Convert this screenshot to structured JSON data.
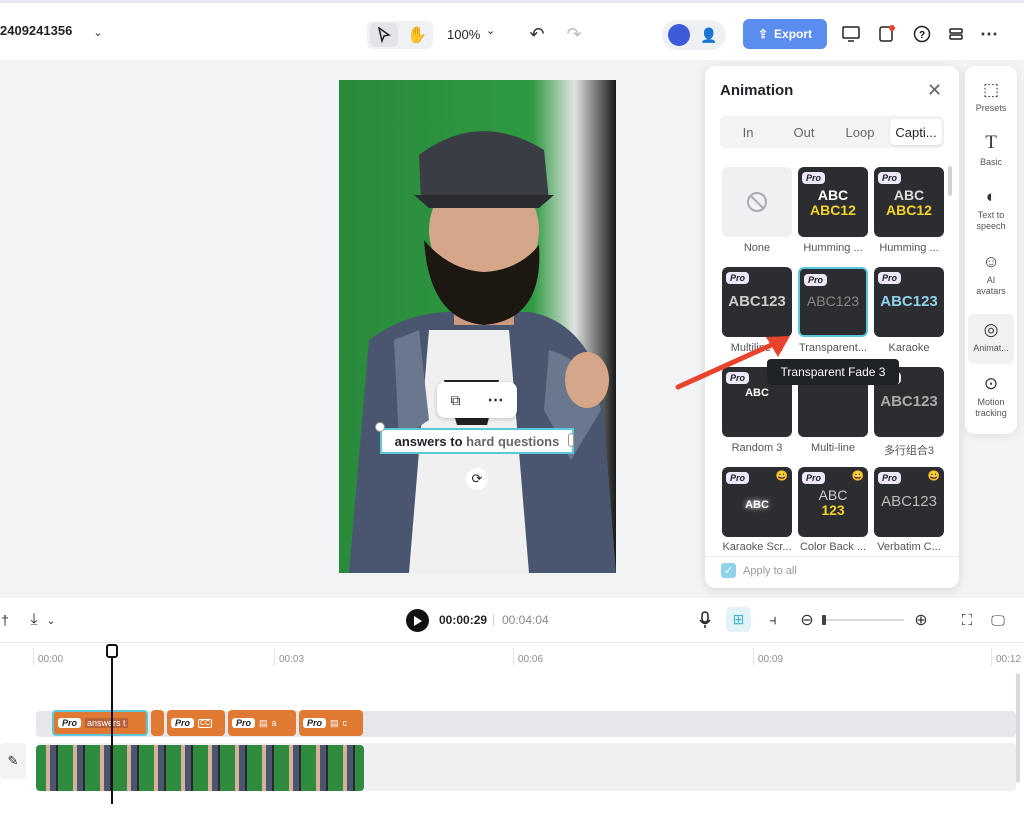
{
  "header": {
    "project_name": "2409241356",
    "zoom": "100%",
    "export_label": "Export"
  },
  "animation_panel": {
    "title": "Animation",
    "tabs": [
      {
        "label": "In",
        "active": false
      },
      {
        "label": "Out",
        "active": false
      },
      {
        "label": "Loop",
        "active": false
      },
      {
        "label": "Capti...",
        "active": true
      }
    ],
    "tiles": [
      {
        "label": "None",
        "pro": false,
        "preview": ""
      },
      {
        "label": "Humming ...",
        "pro": true,
        "preview": "ABC ABC12"
      },
      {
        "label": "Humming ...",
        "pro": true,
        "preview": "ABC ABC12"
      },
      {
        "label": "Multiline ...",
        "pro": true,
        "preview": "ABC123"
      },
      {
        "label": "Transparent...",
        "pro": true,
        "preview": "ABC123",
        "selected": true
      },
      {
        "label": "Karaoke",
        "pro": true,
        "preview": "ABC123"
      },
      {
        "label": "Random 3",
        "pro": true,
        "preview": "ABC"
      },
      {
        "label": "Multi-line",
        "pro": false,
        "preview": ""
      },
      {
        "label": "多行组合3",
        "pro": true,
        "preview": "ABC123"
      },
      {
        "label": "Karaoke Scr...",
        "pro": true,
        "preview": "ABC"
      },
      {
        "label": "Color Back ...",
        "pro": true,
        "preview": "ABC 123"
      },
      {
        "label": "Verbatim C...",
        "pro": true,
        "preview": "ABC123"
      }
    ],
    "pro_badge": "Pro",
    "apply_to_all": "Apply to all",
    "tooltip": "Transparent Fade 3"
  },
  "rail": [
    {
      "label": "Presets",
      "icon": "presets-icon"
    },
    {
      "label": "Basic",
      "icon": "text-icon"
    },
    {
      "label": "Text to speech",
      "icon": "speech-icon"
    },
    {
      "label": "AI avatars",
      "icon": "avatar-icon"
    },
    {
      "label": "Animat...",
      "icon": "animation-icon",
      "active": true
    },
    {
      "label": "Motion tracking",
      "icon": "motion-tracking-icon"
    }
  ],
  "caption": {
    "text_a": "answers to ",
    "text_b": "hard ",
    "text_c": "questions"
  },
  "playback": {
    "current_time": "00:00:29",
    "total_time": "00:04:04"
  },
  "timeline": {
    "ticks": [
      "00:00",
      "00:03",
      "00:06",
      "00:09",
      "00:12"
    ],
    "clips": [
      {
        "pro": "Pro",
        "text": "answers t"
      },
      {
        "pro": "",
        "text": ""
      },
      {
        "pro": "Pro",
        "text": "CC"
      },
      {
        "pro": "Pro",
        "text": "a"
      },
      {
        "pro": "Pro",
        "text": "c"
      }
    ]
  },
  "colors": {
    "accent": "#4a90e2",
    "selected_outline": "#5bc8d9",
    "clip_orange": "#e07a32",
    "arrow_red": "#e8432d"
  }
}
